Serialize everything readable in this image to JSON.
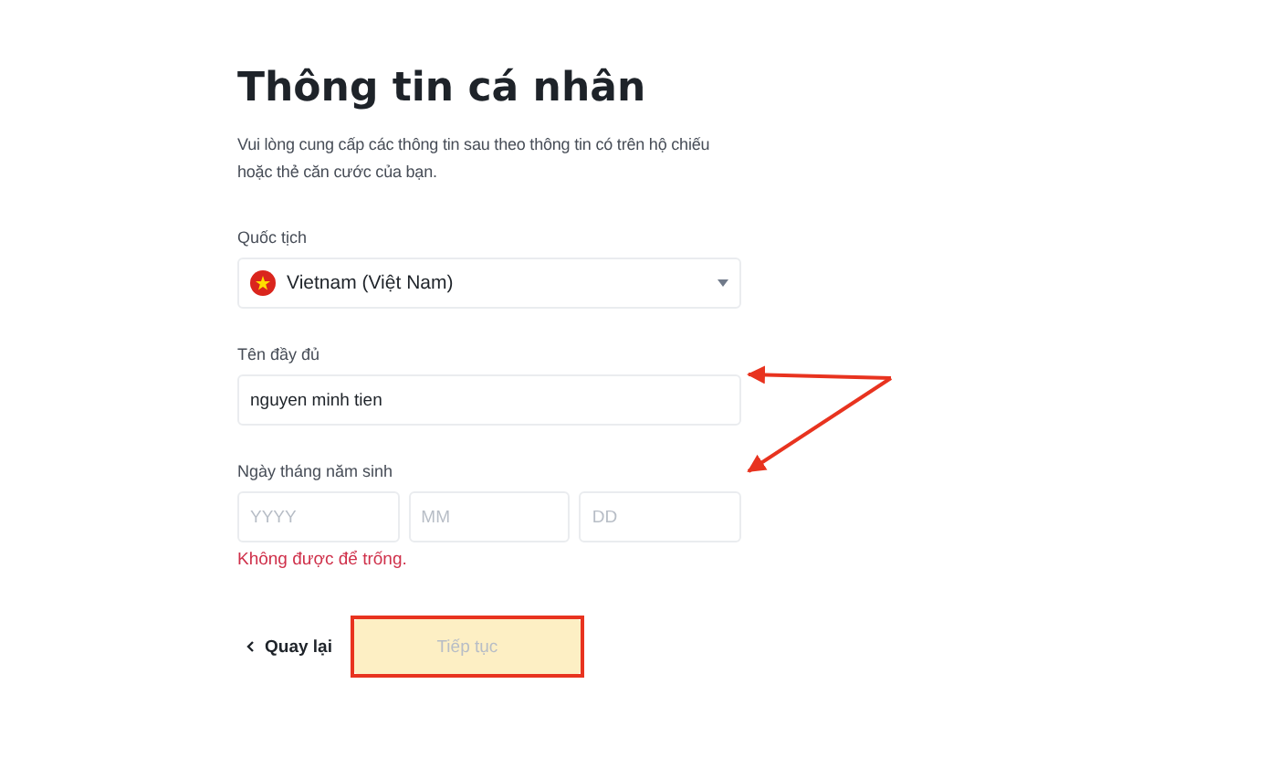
{
  "title": "Thông tin cá nhân",
  "description": "Vui lòng cung cấp các thông tin sau theo thông tin có trên hộ chiếu hoặc thẻ căn cước của bạn.",
  "nationality": {
    "label": "Quốc tịch",
    "value": "Vietnam (Việt Nam)"
  },
  "full_name": {
    "label": "Tên đầy đủ",
    "value": "nguyen minh tien"
  },
  "birth_date": {
    "label": "Ngày tháng năm sinh",
    "fields": [
      {
        "placeholder": "YYYY"
      },
      {
        "placeholder": "MM"
      },
      {
        "placeholder": "DD"
      }
    ],
    "error": "Không được để trống."
  },
  "back": {
    "label": "Quay lại"
  },
  "continue": {
    "label": "Tiếp tục",
    "disabled": true
  }
}
